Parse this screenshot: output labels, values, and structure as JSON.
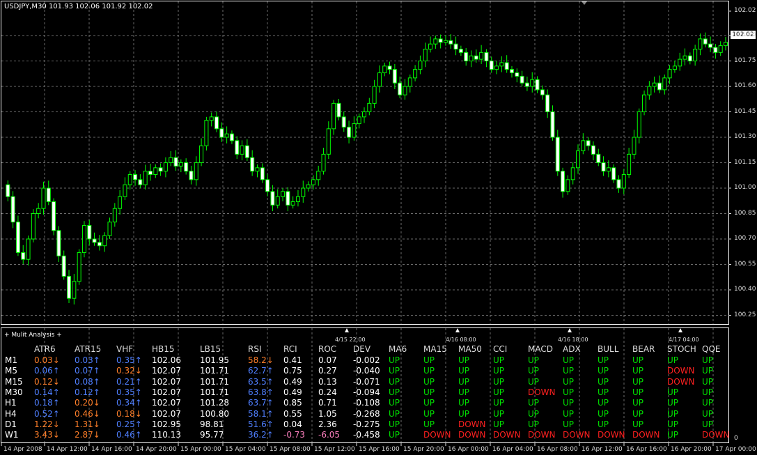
{
  "window": {
    "title": "USDJPY,M30  101.93 102.06 101.92 102.02",
    "current_price": "102.02"
  },
  "price_axis": [
    "102.02",
    "101.90",
    "101.75",
    "101.60",
    "101.45",
    "101.30",
    "101.15",
    "101.00",
    "100.85",
    "100.70",
    "100.55",
    "100.40",
    "100.25"
  ],
  "time_axis": [
    "14 Apr 2008",
    "14 Apr 12:00",
    "14 Apr 16:00",
    "14 Apr 20:00",
    "15 Apr 00:00",
    "15 Apr 04:00",
    "15 Apr 08:00",
    "15 Apr 12:00",
    "15 Apr 16:00",
    "15 Apr 20:00",
    "16 Apr 00:00",
    "16 Apr 04:00",
    "16 Apr 08:00",
    "16 Apr 12:00",
    "16 Apr 16:00",
    "16 Apr 20:00",
    "17 Apr 00:00"
  ],
  "markers": [
    "4/15 22:00",
    "4/16 08:00",
    "4/16 18:00",
    "4/17 04:00"
  ],
  "subwindow": {
    "title": "+ Mulit Analysis +",
    "axis_top": "",
    "axis_zero": "0"
  },
  "colors": {
    "up": "#00e000",
    "down": "#ff2020",
    "blue": "#4f7fff",
    "orange": "#ff7f2a",
    "white": "#ffffff",
    "pink": "#ff80c0",
    "grid": "#6a6a6a",
    "candle": "#00ff00"
  },
  "analysis": {
    "headers": [
      "ATR6",
      "ATR15",
      "VHF",
      "HB15",
      "LB15",
      "RSI",
      "RCI",
      "ROC",
      "DEV",
      "MA6",
      "MA15",
      "MA50",
      "CCI",
      "MACD",
      "ADX",
      "BULL",
      "BEAR",
      "STOCH",
      "QQE"
    ],
    "rows": [
      {
        "tf": "M1",
        "cells": [
          [
            "0.03↓",
            "orange"
          ],
          [
            "0.03↑",
            "blue"
          ],
          [
            "0.35↑",
            "blue"
          ],
          [
            "102.06",
            "white"
          ],
          [
            "101.95",
            "white"
          ],
          [
            "58.2↓",
            "orange"
          ],
          [
            "0.41",
            "white"
          ],
          [
            "0.07",
            "white"
          ],
          [
            "-0.002",
            "white"
          ],
          [
            "UP",
            "up"
          ],
          [
            "UP",
            "up"
          ],
          [
            "UP",
            "up"
          ],
          [
            "UP",
            "up"
          ],
          [
            "UP",
            "up"
          ],
          [
            "UP",
            "up"
          ],
          [
            "UP",
            "up"
          ],
          [
            "UP",
            "up"
          ],
          [
            "UP",
            "up"
          ],
          [
            "UP",
            "up"
          ]
        ]
      },
      {
        "tf": "M5",
        "cells": [
          [
            "0.06↑",
            "blue"
          ],
          [
            "0.07↑",
            "blue"
          ],
          [
            "0.32↓",
            "orange"
          ],
          [
            "102.07",
            "white"
          ],
          [
            "101.71",
            "white"
          ],
          [
            "62.7↑",
            "blue"
          ],
          [
            "0.75",
            "white"
          ],
          [
            "0.27",
            "white"
          ],
          [
            "-0.040",
            "white"
          ],
          [
            "UP",
            "up"
          ],
          [
            "UP",
            "up"
          ],
          [
            "UP",
            "up"
          ],
          [
            "UP",
            "up"
          ],
          [
            "UP",
            "up"
          ],
          [
            "UP",
            "up"
          ],
          [
            "UP",
            "up"
          ],
          [
            "UP",
            "up"
          ],
          [
            "DOWN",
            "down"
          ],
          [
            "UP",
            "up"
          ]
        ]
      },
      {
        "tf": "M15",
        "cells": [
          [
            "0.12↓",
            "orange"
          ],
          [
            "0.08↑",
            "blue"
          ],
          [
            "0.21↑",
            "blue"
          ],
          [
            "102.07",
            "white"
          ],
          [
            "101.71",
            "white"
          ],
          [
            "63.5↑",
            "blue"
          ],
          [
            "0.49",
            "white"
          ],
          [
            "0.13",
            "white"
          ],
          [
            "-0.071",
            "white"
          ],
          [
            "UP",
            "up"
          ],
          [
            "UP",
            "up"
          ],
          [
            "UP",
            "up"
          ],
          [
            "UP",
            "up"
          ],
          [
            "UP",
            "up"
          ],
          [
            "UP",
            "up"
          ],
          [
            "UP",
            "up"
          ],
          [
            "UP",
            "up"
          ],
          [
            "DOWN",
            "down"
          ],
          [
            "UP",
            "up"
          ]
        ]
      },
      {
        "tf": "M30",
        "cells": [
          [
            "0.14↑",
            "blue"
          ],
          [
            "0.12↑",
            "blue"
          ],
          [
            "0.35↑",
            "blue"
          ],
          [
            "102.07",
            "white"
          ],
          [
            "101.71",
            "white"
          ],
          [
            "63.8↑",
            "blue"
          ],
          [
            "0.49",
            "white"
          ],
          [
            "0.24",
            "white"
          ],
          [
            "-0.094",
            "white"
          ],
          [
            "UP",
            "up"
          ],
          [
            "UP",
            "up"
          ],
          [
            "UP",
            "up"
          ],
          [
            "UP",
            "up"
          ],
          [
            "DOWN",
            "down"
          ],
          [
            "UP",
            "up"
          ],
          [
            "UP",
            "up"
          ],
          [
            "UP",
            "up"
          ],
          [
            "UP",
            "up"
          ],
          [
            "UP",
            "up"
          ]
        ]
      },
      {
        "tf": "H1",
        "cells": [
          [
            "0.18↑",
            "blue"
          ],
          [
            "0.20↓",
            "orange"
          ],
          [
            "0.34↑",
            "blue"
          ],
          [
            "102.07",
            "white"
          ],
          [
            "101.28",
            "white"
          ],
          [
            "63.7↑",
            "blue"
          ],
          [
            "0.85",
            "white"
          ],
          [
            "0.71",
            "white"
          ],
          [
            "-0.108",
            "white"
          ],
          [
            "UP",
            "up"
          ],
          [
            "UP",
            "up"
          ],
          [
            "UP",
            "up"
          ],
          [
            "UP",
            "up"
          ],
          [
            "UP",
            "up"
          ],
          [
            "UP",
            "up"
          ],
          [
            "UP",
            "up"
          ],
          [
            "UP",
            "up"
          ],
          [
            "UP",
            "up"
          ],
          [
            "UP",
            "up"
          ]
        ]
      },
      {
        "tf": "H4",
        "cells": [
          [
            "0.52↑",
            "blue"
          ],
          [
            "0.46↓",
            "orange"
          ],
          [
            "0.18↓",
            "orange"
          ],
          [
            "102.07",
            "white"
          ],
          [
            "100.80",
            "white"
          ],
          [
            "58.1↑",
            "blue"
          ],
          [
            "0.55",
            "white"
          ],
          [
            "1.05",
            "white"
          ],
          [
            "-0.268",
            "white"
          ],
          [
            "UP",
            "up"
          ],
          [
            "UP",
            "up"
          ],
          [
            "UP",
            "up"
          ],
          [
            "UP",
            "up"
          ],
          [
            "UP",
            "up"
          ],
          [
            "UP",
            "up"
          ],
          [
            "UP",
            "up"
          ],
          [
            "UP",
            "up"
          ],
          [
            "UP",
            "up"
          ],
          [
            "UP",
            "up"
          ]
        ]
      },
      {
        "tf": "D1",
        "cells": [
          [
            "1.22↓",
            "orange"
          ],
          [
            "1.31↓",
            "orange"
          ],
          [
            "0.25↑",
            "blue"
          ],
          [
            "102.95",
            "white"
          ],
          [
            "98.81",
            "white"
          ],
          [
            "51.6↑",
            "blue"
          ],
          [
            "0.04",
            "white"
          ],
          [
            "2.36",
            "white"
          ],
          [
            "-0.275",
            "white"
          ],
          [
            "UP",
            "up"
          ],
          [
            "UP",
            "up"
          ],
          [
            "DOWN",
            "down"
          ],
          [
            "UP",
            "up"
          ],
          [
            "UP",
            "up"
          ],
          [
            "UP",
            "up"
          ],
          [
            "UP",
            "up"
          ],
          [
            "UP",
            "up"
          ],
          [
            "UP",
            "up"
          ],
          [
            "UP",
            "up"
          ]
        ]
      },
      {
        "tf": "W1",
        "cells": [
          [
            "3.43↓",
            "orange"
          ],
          [
            "2.87↓",
            "orange"
          ],
          [
            "0.46↑",
            "blue"
          ],
          [
            "110.13",
            "white"
          ],
          [
            "95.77",
            "white"
          ],
          [
            "36.2↑",
            "blue"
          ],
          [
            "-0.73",
            "pink"
          ],
          [
            "-6.05",
            "pink"
          ],
          [
            "-0.458",
            "white"
          ],
          [
            "UP",
            "up"
          ],
          [
            "DOWN",
            "down"
          ],
          [
            "DOWN",
            "down"
          ],
          [
            "DOWN",
            "down"
          ],
          [
            "DOWN",
            "down"
          ],
          [
            "DOWN",
            "down"
          ],
          [
            "DOWN",
            "down"
          ],
          [
            "DOWN",
            "down"
          ],
          [
            "UP",
            "up"
          ],
          [
            "DOWN",
            "down"
          ]
        ]
      }
    ]
  }
}
